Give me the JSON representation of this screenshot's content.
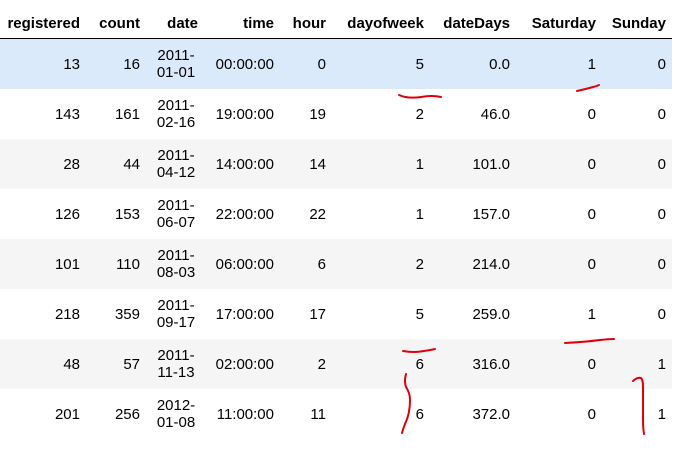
{
  "table": {
    "columns": [
      "registered",
      "count",
      "date",
      "time",
      "hour",
      "dayofweek",
      "dateDays",
      "Saturday",
      "Sunday"
    ],
    "rows": [
      {
        "registered": "13",
        "count": "16",
        "date": [
          "2011-",
          "01-01"
        ],
        "time": "00:00:00",
        "hour": "0",
        "dayofweek": "5",
        "dateDays": "0.0",
        "saturday": "1",
        "sunday": "0"
      },
      {
        "registered": "143",
        "count": "161",
        "date": [
          "2011-",
          "02-16"
        ],
        "time": "19:00:00",
        "hour": "19",
        "dayofweek": "2",
        "dateDays": "46.0",
        "saturday": "0",
        "sunday": "0"
      },
      {
        "registered": "28",
        "count": "44",
        "date": [
          "2011-",
          "04-12"
        ],
        "time": "14:00:00",
        "hour": "14",
        "dayofweek": "1",
        "dateDays": "101.0",
        "saturday": "0",
        "sunday": "0"
      },
      {
        "registered": "126",
        "count": "153",
        "date": [
          "2011-",
          "06-07"
        ],
        "time": "22:00:00",
        "hour": "22",
        "dayofweek": "1",
        "dateDays": "157.0",
        "saturday": "0",
        "sunday": "0"
      },
      {
        "registered": "101",
        "count": "110",
        "date": [
          "2011-",
          "08-03"
        ],
        "time": "06:00:00",
        "hour": "6",
        "dayofweek": "2",
        "dateDays": "214.0",
        "saturday": "0",
        "sunday": "0"
      },
      {
        "registered": "218",
        "count": "359",
        "date": [
          "2011-",
          "09-17"
        ],
        "time": "17:00:00",
        "hour": "17",
        "dayofweek": "5",
        "dateDays": "259.0",
        "saturday": "1",
        "sunday": "0"
      },
      {
        "registered": "48",
        "count": "57",
        "date": [
          "2011-",
          "11-13"
        ],
        "time": "02:00:00",
        "hour": "2",
        "dayofweek": "6",
        "dateDays": "316.0",
        "saturday": "0",
        "sunday": "1"
      },
      {
        "registered": "201",
        "count": "256",
        "date": [
          "2012-",
          "01-08"
        ],
        "time": "11:00:00",
        "hour": "11",
        "dayofweek": "6",
        "dateDays": "372.0",
        "saturday": "0",
        "sunday": "1"
      }
    ]
  },
  "annotation_color": "#e0000c",
  "selected_row_color": "#dbeafa"
}
